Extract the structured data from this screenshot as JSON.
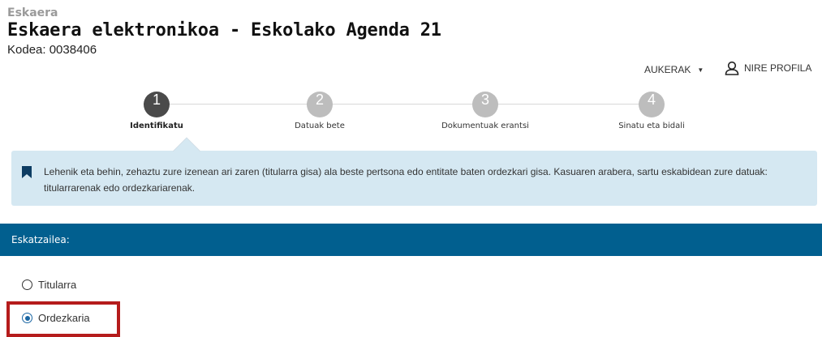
{
  "header": {
    "kicker": "Eskaera",
    "title": "Eskaera elektronikoa - Eskolako Agenda 21",
    "code": "Kodea: 0038406"
  },
  "topnav": {
    "options_label": "AUKERAK",
    "profile_label": "NIRE PROFILA",
    "options_icon": "caret-down-icon",
    "profile_icon": "user-icon"
  },
  "steps": [
    {
      "number": "1",
      "label": "Identifikatu",
      "active": true
    },
    {
      "number": "2",
      "label": "Datuak bete",
      "active": false
    },
    {
      "number": "3",
      "label": "Dokumentuak erantsi",
      "active": false
    },
    {
      "number": "4",
      "label": "Sinatu eta bidali",
      "active": false
    }
  ],
  "info": {
    "icon": "bookmark-icon",
    "text": "Lehenik eta behin, zehaztu zure izenean ari zaren (titularra gisa) ala beste pertsona edo entitate baten ordezkari gisa. Kasuaren arabera, sartu eskabidean zure datuak: titularrarenak edo ordezkariarenak."
  },
  "section": {
    "title": "Eskatzailea:"
  },
  "applicant_options": [
    {
      "label": "Titularra",
      "checked": false
    },
    {
      "label": "Ordezkaria",
      "checked": true
    }
  ],
  "colors": {
    "section_bar": "#015f8f",
    "info_bg": "#d5e8f2",
    "step_active": "#4a4a4a",
    "step_inactive": "#bdbdbd",
    "highlight": "#b51c1c"
  }
}
